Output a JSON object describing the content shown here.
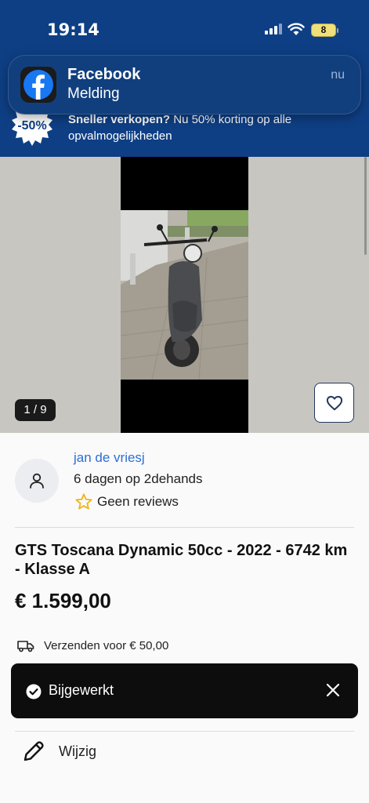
{
  "status_bar": {
    "time": "19:14",
    "battery": "8"
  },
  "notification": {
    "app": "Facebook",
    "message": "Melding",
    "time": "nu"
  },
  "promo": {
    "badge": "-50%",
    "text_bold": "Sneller verkopen?",
    "text_rest": " Nu 50% korting op alle opvalmogelijkheden"
  },
  "gallery": {
    "counter": "1 / 9"
  },
  "seller": {
    "name": "jan de vriesj",
    "since": "6 dagen op 2dehands",
    "reviews": "Geen reviews"
  },
  "listing": {
    "title": "GTS Toscana Dynamic 50cc - 2022 - 6742 km - Klasse A",
    "price": "€ 1.599,00",
    "shipping": "Verzenden voor € 50,00"
  },
  "toast": {
    "text": "Bijgewerkt"
  },
  "actions": {
    "edit_label": "Wijzig"
  },
  "colors": {
    "header": "#0e3f85",
    "link": "#2a6fd6",
    "star": "#f2b21b"
  }
}
